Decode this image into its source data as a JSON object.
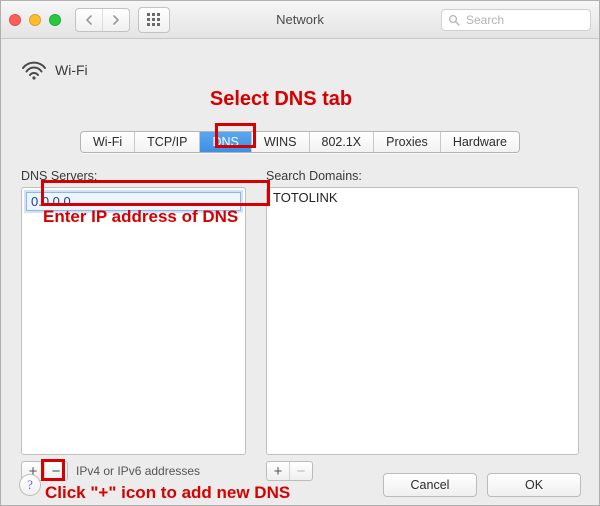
{
  "window": {
    "title": "Network"
  },
  "toolbar": {
    "search_placeholder": "Search"
  },
  "header": {
    "connection_name": "Wi-Fi"
  },
  "tabs": {
    "items": [
      "Wi-Fi",
      "TCP/IP",
      "DNS",
      "WINS",
      "802.1X",
      "Proxies",
      "Hardware"
    ],
    "active_index": 2
  },
  "dns": {
    "servers_label": "DNS Servers:",
    "input_value": "0.0.0.0",
    "footer_hint": "IPv4 or IPv6 addresses"
  },
  "search_domains": {
    "label": "Search Domains:",
    "items": [
      "TOTOLINK"
    ]
  },
  "buttons": {
    "plus": "+",
    "minus": "−",
    "help": "?",
    "cancel": "Cancel",
    "ok": "OK"
  },
  "annotations": {
    "select_tab": "Select DNS tab",
    "enter_ip": "Enter IP address of DNS",
    "click_plus": "Click \"+\" icon to add new DNS"
  }
}
